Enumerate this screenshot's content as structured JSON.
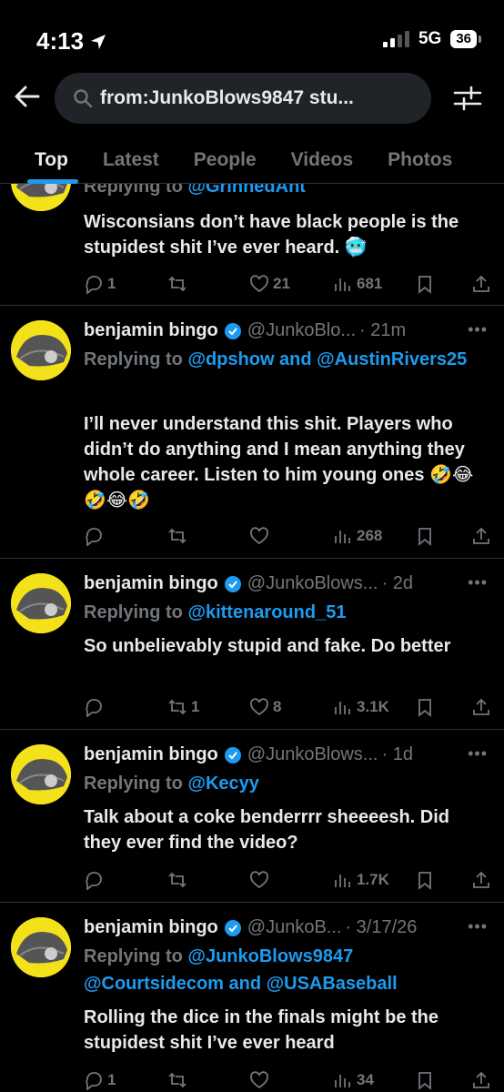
{
  "status": {
    "time": "4:13",
    "network": "5G",
    "battery": "36"
  },
  "search": {
    "query": "from:JunkoBlows9847 stu..."
  },
  "tabs": [
    "Top",
    "Latest",
    "People",
    "Videos",
    "Photos"
  ],
  "colors": {
    "accent": "#1d9bf0",
    "background": "#000000",
    "muted": "#71767b",
    "text": "#e7e9ea"
  },
  "tweets": [
    {
      "reply_prefix": "Replying to ",
      "reply_to": "@GrinnedAnt",
      "text": "Wisconsians don’t have black people is the stupidest shit I’ve ever heard. 🥶",
      "replies": "1",
      "retweets": "",
      "likes": "21",
      "views": "681"
    },
    {
      "name": "benjamin bingo",
      "handle": "@JunkoBlo...",
      "time": "· 21m",
      "reply_prefix": "Replying to ",
      "reply_to": "@dpshow and @AustinRivers25",
      "text": "I’ll never understand this shit. Players who didn’t do anything and I mean anything they whole career. Listen to him young ones 🤣😂🤣😂🤣",
      "replies": "",
      "retweets": "",
      "likes": "",
      "views": "268"
    },
    {
      "name": "benjamin bingo",
      "handle": "@JunkoBlows...",
      "time": "· 2d",
      "reply_prefix": "Replying to ",
      "reply_to": "@kittenaround_51",
      "text": "So unbelievably stupid and fake. Do better",
      "replies": "",
      "retweets": "1",
      "likes": "8",
      "views": "3.1K"
    },
    {
      "name": "benjamin bingo",
      "handle": "@JunkoBlows...",
      "time": "· 1d",
      "reply_prefix": "Replying to ",
      "reply_to": "@Kecyy",
      "text": "Talk about a coke benderrrr sheeeesh. Did they ever find the video?",
      "replies": "",
      "retweets": "",
      "likes": "",
      "views": "1.7K"
    },
    {
      "name": "benjamin bingo",
      "handle": "@JunkoB...",
      "time": "· 3/17/26",
      "reply_prefix": "Replying to ",
      "reply_to": "@JunkoBlows9847 @Courtsidecom and @USABaseball",
      "text": "Rolling the dice in the finals might be the stupidest shit I’ve ever heard",
      "replies": "1",
      "retweets": "",
      "likes": "",
      "views": "34"
    }
  ]
}
